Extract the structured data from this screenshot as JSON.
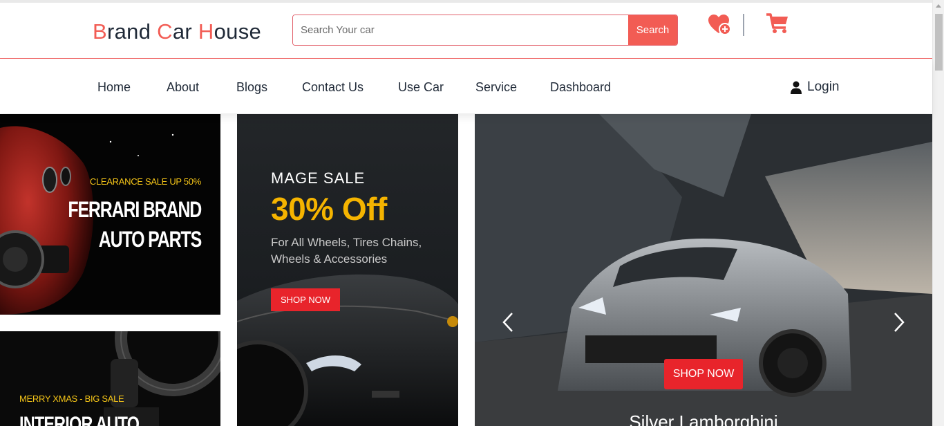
{
  "header": {
    "brand_b": "B",
    "brand_rand": "rand ",
    "brand_c": "C",
    "brand_ar": "ar ",
    "brand_h": "H",
    "brand_ouse": "ouse",
    "search_placeholder": "Search Your car",
    "search_button": "Search",
    "wishlist_icon": "heart-plus-icon",
    "cart_icon": "cart-icon"
  },
  "nav": {
    "items": [
      "Home",
      "About",
      "Blogs",
      "Contact Us",
      "Use Car",
      "Service",
      "Dashboard"
    ],
    "login": "Login"
  },
  "banners": {
    "ferrari": {
      "sale": "CLEARANCE SALE UP 50%",
      "line1": "FERRARI BRAND",
      "line2": "AUTO PARTS"
    },
    "interior": {
      "sale": "MERRY XMAS - BIG SALE",
      "line1": "INTERIOR AUTO"
    },
    "mage": {
      "heading": "MAGE SALE",
      "discount": "30% Off",
      "line1": "For All Wheels, Tires Chains,",
      "line2": "Wheels & Accessories",
      "button": "SHOP NOW"
    },
    "slider": {
      "button": "SHOP NOW",
      "caption": "Silver Lamborghini"
    }
  },
  "colors": {
    "accent": "#f25c54",
    "shop_red": "#e8242b",
    "gold": "#f5b400"
  }
}
